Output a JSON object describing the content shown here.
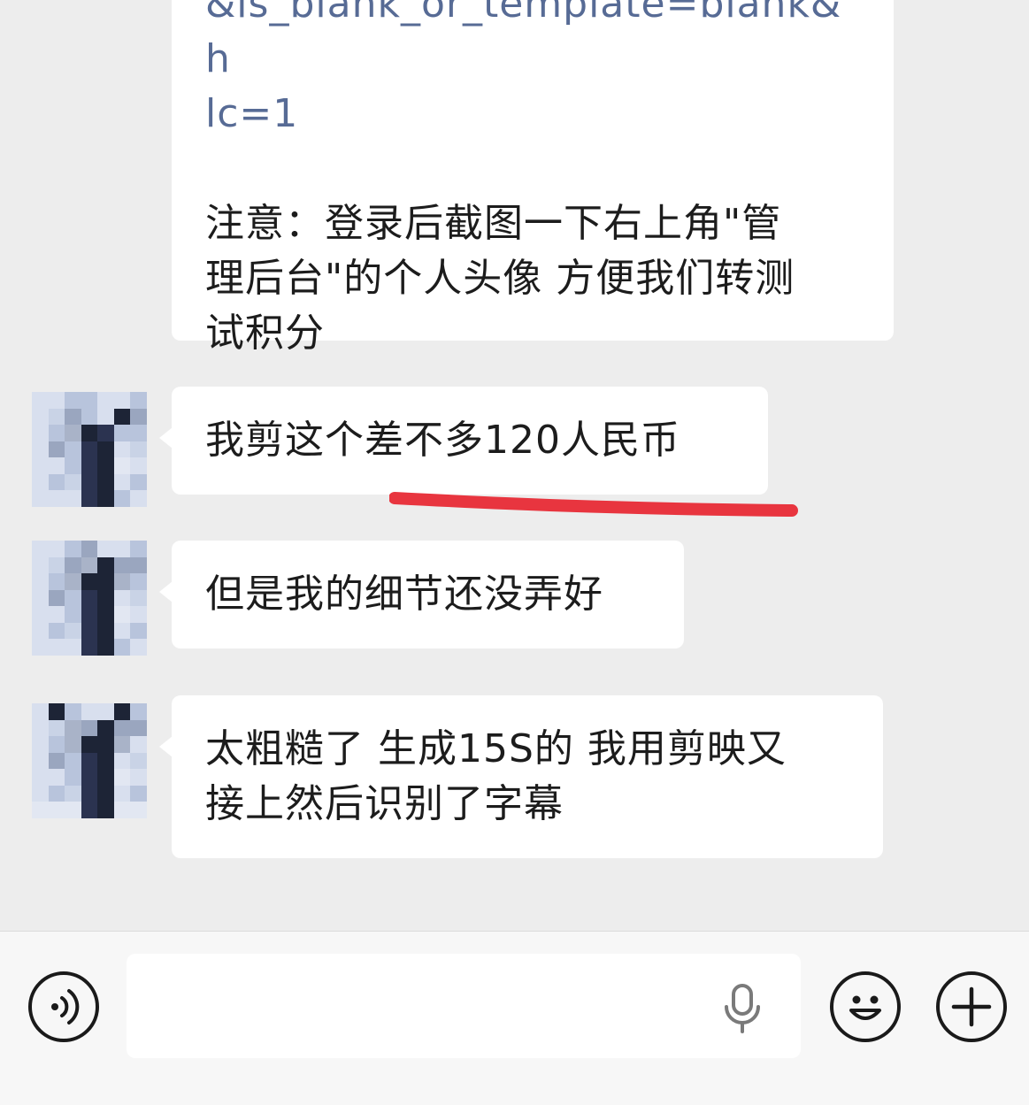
{
  "messages": [
    {
      "link_lines": [
        "&is_blank_or_template=blank&h",
        "lc=1"
      ],
      "note": "注意：登录后截图一下右上角\"管\n理后台\"的个人头像 方便我们转测\n试积分"
    },
    {
      "text": "我剪这个差不多120人民币"
    },
    {
      "text": "但是我的细节还没弄好"
    },
    {
      "text_lines": [
        "太粗糙了 生成15S的 我用剪映又",
        "接上然后识别了字幕"
      ]
    }
  ],
  "input": {
    "placeholder": ""
  },
  "icons": {
    "voice": "voice-wave-icon",
    "mic": "microphone-icon",
    "emoji": "smiley-icon",
    "plus": "plus-icon"
  },
  "colors": {
    "background": "#ededed",
    "bubble": "#ffffff",
    "link": "#576b95",
    "annotation": "#e8353f"
  }
}
